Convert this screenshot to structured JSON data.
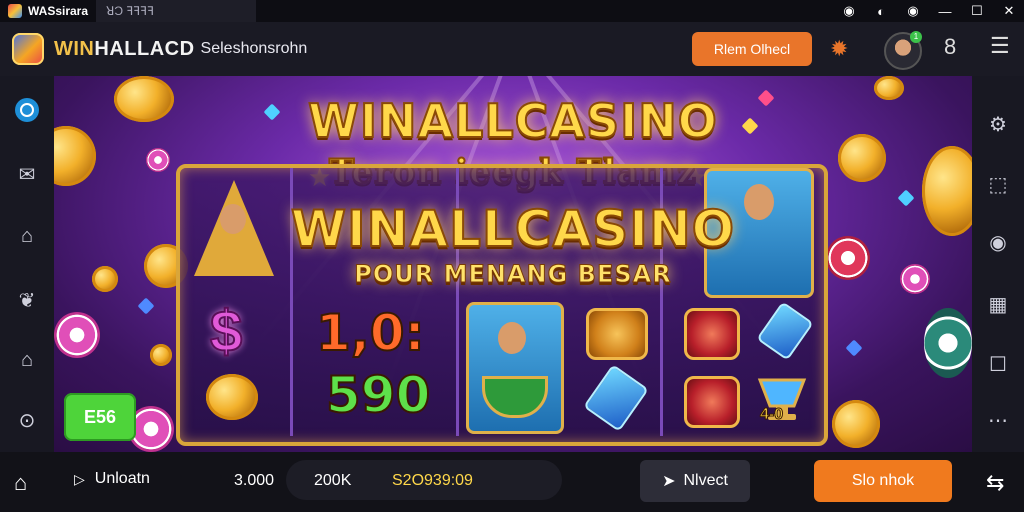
{
  "window": {
    "app_name": "WASsirara",
    "tab_label": "ꓤƆ ꟻꟻꟻꟻ",
    "controls": [
      "◉",
      "◐",
      "◉",
      "—",
      "☐",
      "✕"
    ]
  },
  "header": {
    "brand": "WIN",
    "brand_rest": "HALLACD",
    "subtitle": "Seleshonsrohn",
    "action_button": "Rlem Olhecl",
    "avatar_badge": "1"
  },
  "banner": {
    "title_top": "WINALLCASINO",
    "title_mid": "Teron ieegk Tlamz",
    "title_main": "WINALLCASINO",
    "tagline": "POUR MENANG BESAR",
    "number_top": "1,0:",
    "number_bottom": "590",
    "cup_value": "4-0",
    "badge_label": "E56",
    "dollar_symbol": "$"
  },
  "bottombar": {
    "play_label": "Unloatn",
    "value_1": "3.000",
    "value_2": "200K",
    "value_3": "S2O939:09",
    "effect_label": "Nlvect",
    "cta_label": "Slo nhok"
  },
  "colors": {
    "accent_orange": "#f07a1e",
    "gold": "#ffd84a",
    "purple": "#6b2aa8",
    "green_badge": "#4ed43a"
  }
}
